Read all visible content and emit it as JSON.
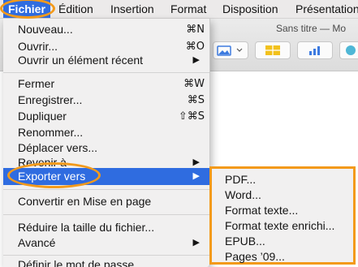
{
  "menubar": {
    "items": [
      {
        "label": "Fichier"
      },
      {
        "label": "Édition"
      },
      {
        "label": "Insertion"
      },
      {
        "label": "Format"
      },
      {
        "label": "Disposition"
      },
      {
        "label": "Présentation"
      }
    ]
  },
  "window": {
    "title": "Sans titre — Mo"
  },
  "file_menu": {
    "items": [
      {
        "label": "Nouveau...",
        "shortcut": "⌘N"
      },
      {
        "label": "Ouvrir...",
        "shortcut": "⌘O"
      },
      {
        "label": "Ouvrir un élément récent",
        "arrow": "▶"
      },
      {
        "label": "Fermer",
        "shortcut": "⌘W"
      },
      {
        "label": "Enregistrer...",
        "shortcut": "⌘S"
      },
      {
        "label": "Dupliquer",
        "shortcut": "⇧⌘S"
      },
      {
        "label": "Renommer..."
      },
      {
        "label": "Déplacer vers..."
      },
      {
        "label": "Revenir à",
        "arrow": "▶"
      },
      {
        "label": "Exporter vers",
        "arrow": "▶"
      },
      {
        "label": "Convertir en Mise en page"
      },
      {
        "label": "Réduire la taille du fichier..."
      },
      {
        "label": "Avancé",
        "arrow": "▶"
      },
      {
        "label": "Définir le mot de passe..."
      }
    ]
  },
  "export_submenu": {
    "items": [
      {
        "label": "PDF..."
      },
      {
        "label": "Word..."
      },
      {
        "label": "Format texte..."
      },
      {
        "label": "Format texte enrichi..."
      },
      {
        "label": "EPUB..."
      },
      {
        "label": "Pages ’09..."
      }
    ]
  },
  "colors": {
    "highlight": "#2f6ce0",
    "annotation": "#f39a1b"
  }
}
